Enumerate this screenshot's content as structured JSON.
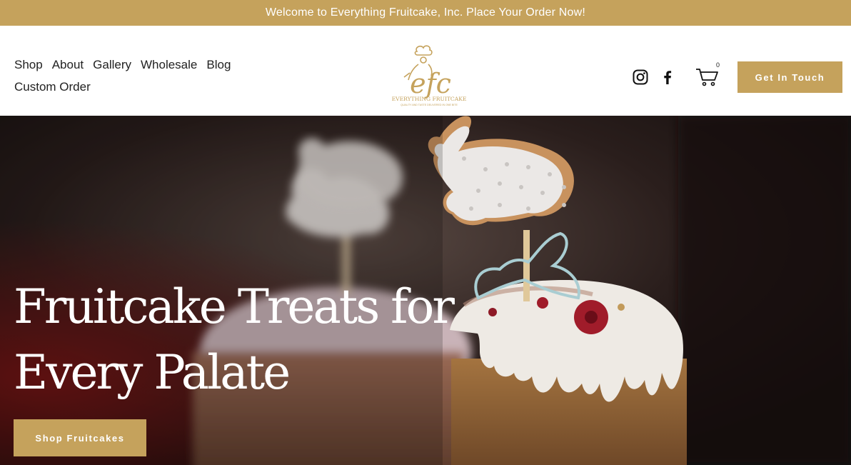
{
  "announcement": {
    "text": "Welcome to Everything Fruitcake, Inc. Place Your Order Now!"
  },
  "nav": {
    "items": [
      {
        "label": "Shop"
      },
      {
        "label": "About"
      },
      {
        "label": "Gallery"
      },
      {
        "label": "Wholesale"
      },
      {
        "label": "Blog"
      },
      {
        "label": "Custom Order"
      }
    ]
  },
  "logo": {
    "monogram": "efc",
    "wordmark": "EVERYTHING FRUITCAKE",
    "tagline": "QUALITY AND TASTE DELIVERED IN ONE BITE"
  },
  "social": {
    "icons": [
      "instagram-icon",
      "facebook-icon"
    ]
  },
  "cart": {
    "icon": "cart-icon",
    "count": "0"
  },
  "header_button": {
    "label": "Get In Touch"
  },
  "hero": {
    "title_line1": "Fruitcake Treats for",
    "title_line2": "Every Palate",
    "button_label": "Shop Fruitcakes"
  },
  "colors": {
    "accent": "#c5a25c",
    "text": "#222222",
    "white": "#ffffff"
  }
}
